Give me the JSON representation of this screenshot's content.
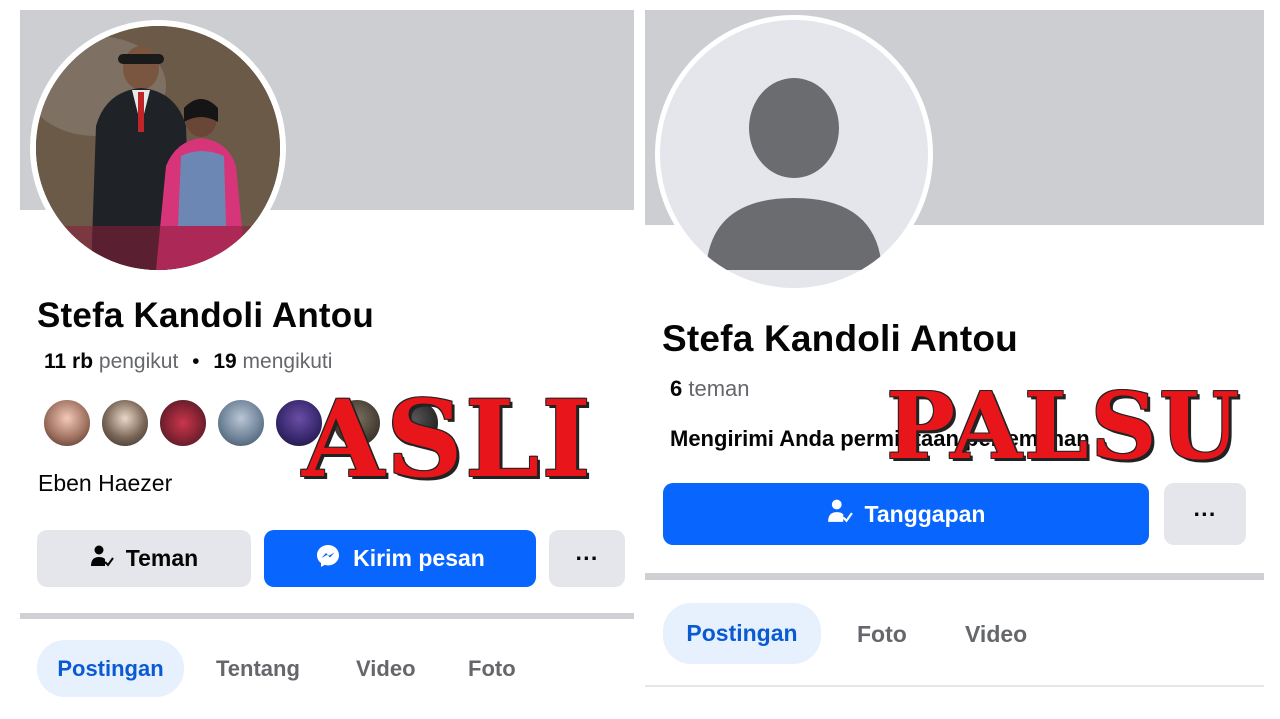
{
  "left": {
    "name": "Stefa Kandoli Antou",
    "followers_count": "11 rb",
    "followers_label": "pengikut",
    "separator": "•",
    "following_count": "19",
    "following_label": "mengikuti",
    "bio": "Eben Haezer",
    "friend_button": "Teman",
    "message_button": "Kirim pesan",
    "more_button": "···",
    "tabs": [
      "Postingan",
      "Tentang",
      "Video",
      "Foto"
    ],
    "stamp": "ASLI"
  },
  "right": {
    "name": "Stefa Kandoli Antou",
    "friends_count": "6",
    "friends_label": "teman",
    "request_text": "Mengirimi Anda permintaan pertemanan",
    "respond_button": "Tanggapan",
    "more_button": "···",
    "tabs": [
      "Postingan",
      "Foto",
      "Video"
    ],
    "stamp": "PALSU"
  },
  "colors": {
    "cover": "#ccced2",
    "primary_blue": "#0866ff",
    "button_gray": "#e4e6eb",
    "stamp_red": "#e8161b"
  },
  "icons": [
    "friend-check-icon",
    "messenger-icon",
    "more-dots-icon",
    "default-avatar-icon"
  ]
}
